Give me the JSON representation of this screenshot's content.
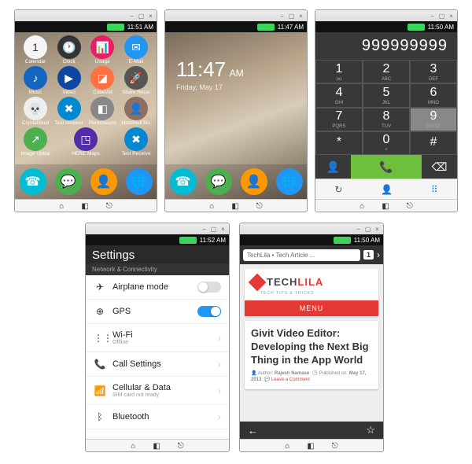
{
  "status": {
    "time1": "11:51 AM",
    "time2": "11:47 AM",
    "time3": "11:50 AM",
    "time4": "11:52 AM",
    "time5": "11:50 AM"
  },
  "apps": [
    {
      "label": "Calendar",
      "color": "#f5f5f5",
      "glyph": "1",
      "tcolor": "#333"
    },
    {
      "label": "Clock",
      "color": "#333",
      "glyph": "🕐"
    },
    {
      "label": "Usage",
      "color": "#e91e63",
      "glyph": "📊"
    },
    {
      "label": "E-Mail",
      "color": "#2196f3",
      "glyph": "✉"
    },
    {
      "label": "Music",
      "color": "#1565c0",
      "glyph": "♪"
    },
    {
      "label": "Video",
      "color": "#0d47a1",
      "glyph": "▶"
    },
    {
      "label": "CubeVid",
      "color": "#ff7043",
      "glyph": "◪"
    },
    {
      "label": "Share Recei",
      "color": "#555",
      "glyph": "🚀"
    },
    {
      "label": "CrystalSkull",
      "color": "#eee",
      "glyph": "💀",
      "tcolor": "#333"
    },
    {
      "label": "Test receiver",
      "color": "#0288d1",
      "glyph": "✖"
    },
    {
      "label": "Permissions",
      "color": "#888",
      "glyph": "◧"
    },
    {
      "label": "HostStubTes",
      "color": "#8d6e63",
      "glyph": "👤"
    },
    {
      "label": "Image Uploa",
      "color": "#4caf50",
      "glyph": "↗"
    },
    {
      "label": "HERE Maps",
      "color": "#512da8",
      "glyph": "◳"
    },
    {
      "label": "Test Receive",
      "color": "#0288d1",
      "glyph": "✖"
    }
  ],
  "dock": [
    {
      "color": "#00bcd4",
      "glyph": "☎"
    },
    {
      "color": "#4caf50",
      "glyph": "💬"
    },
    {
      "color": "#ff9800",
      "glyph": "👤"
    },
    {
      "color": "#2196f3",
      "glyph": "🌐"
    }
  ],
  "lock": {
    "time": "11:47",
    "ampm": "AM",
    "date": "Friday, May 17"
  },
  "dialer": {
    "number": "999999999",
    "keys": [
      {
        "n": "1",
        "l": "oo"
      },
      {
        "n": "2",
        "l": "ABC"
      },
      {
        "n": "3",
        "l": "DEF"
      },
      {
        "n": "4",
        "l": "GHI"
      },
      {
        "n": "5",
        "l": "JKL"
      },
      {
        "n": "6",
        "l": "MNO"
      },
      {
        "n": "7",
        "l": "PQRS"
      },
      {
        "n": "8",
        "l": "TUV"
      },
      {
        "n": "9",
        "l": "WXYZ",
        "hl": true
      },
      {
        "n": "*",
        "l": ""
      },
      {
        "n": "0",
        "l": "+"
      },
      {
        "n": "#",
        "l": ""
      }
    ]
  },
  "settings": {
    "title": "Settings",
    "section": "Network & Connectivity",
    "items": [
      {
        "icon": "✈",
        "label": "Airplane mode",
        "toggle": false
      },
      {
        "icon": "⊕",
        "label": "GPS",
        "toggle": true
      },
      {
        "icon": "⋮⋮",
        "label": "Wi-Fi",
        "sub": "Offline",
        "nav": true
      },
      {
        "icon": "📞",
        "label": "Call Settings",
        "nav": true
      },
      {
        "icon": "📶",
        "label": "Cellular & Data",
        "sub": "SIM card not ready",
        "nav": true
      },
      {
        "icon": "ᛒ",
        "label": "Bluetooth",
        "nav": true
      }
    ]
  },
  "browser": {
    "url": "TechLila • Tech Article ...",
    "tabs": "1",
    "brand": "TECH",
    "brand2": "LILA",
    "tagline": "TECH TIPS & TRICKS",
    "menu": "MENU",
    "article_title": "Givit Video Editor: Developing the Next Big Thing in the App World",
    "author_label": "Author:",
    "author": "Rajesh Namase",
    "pub_label": "Published on:",
    "pub": "May 17, 2013",
    "comment": "Leave a Comment"
  }
}
